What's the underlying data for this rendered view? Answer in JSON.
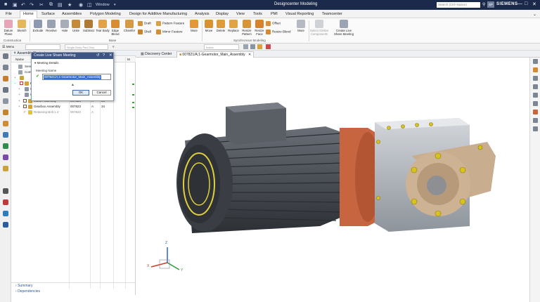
{
  "titlebar": {
    "window_label": "Window",
    "title": "Designcenter  Modeling",
    "search_placeholder": "Search (Ctrl+Space)",
    "brand": "SIEMENS",
    "colors": {
      "background": "#1b2a4a"
    }
  },
  "menu": {
    "tabs": [
      "File",
      "Home",
      "Surface",
      "Assemblies",
      "Polygon Modeling",
      "Design for Additive Manufacturing",
      "Analysis",
      "Display",
      "View",
      "Tools",
      "PMI",
      "Visual Reporting",
      "Teamcenter"
    ],
    "active": "Home"
  },
  "ribbon": {
    "buttons": {
      "datum_plane": "Datum Plane",
      "sketch": "Sketch",
      "extrude": "Extrude",
      "revolve": "Revolve",
      "hole": "Hole",
      "unite": "Unite",
      "subtract": "Subtract",
      "tear_body": "Tear Body",
      "edge_blend": "Edge Blend",
      "chamfer": "Chamfer",
      "draft": "Draft",
      "shell": "Shell",
      "pattern_feature": "Pattern Feature",
      "mirror_feature": "Mirror Feature",
      "more_base": "More",
      "move": "Move",
      "delete": "Delete",
      "replace": "Replace",
      "resize_pattern": "Resize Pattern",
      "resize_face": "Resize Face",
      "offset": "Offset",
      "resize_blend": "Resize Blend",
      "more_sync": "More",
      "select_similar": "Select Similar Components",
      "create_live_share": "Create Live Share Meeting"
    },
    "groups": {
      "construction": "Construction",
      "base": "Base",
      "synchronous": "Synchronous Modeling"
    }
  },
  "toolbar": {
    "menu_label": "Menu",
    "filter_value": "Single Body Part Only",
    "inside_value": "Inside"
  },
  "navigator": {
    "title": "Assembly Navigator",
    "columns": [
      "Name",
      "",
      "",
      "M"
    ],
    "rows": [
      {
        "name": "Sessi",
        "c2": "",
        "c3": "",
        "c4": ""
      },
      {
        "name": "Com",
        "c2": "",
        "c3": "",
        "c4": ""
      },
      {
        "name": "",
        "c2": "",
        "c3": "",
        "c4": ""
      },
      {
        "name": "G",
        "c2": "",
        "c3": "",
        "c4": ""
      },
      {
        "name": "C",
        "c2": "",
        "c3": "",
        "c4": ""
      },
      {
        "name": "C",
        "c2": "",
        "c3": "",
        "c4": ""
      },
      {
        "name": "Motor Assembly",
        "c2": "007824",
        "c3": "A",
        "c4": "86"
      },
      {
        "name": "Gearbox Assembly",
        "c2": "007823",
        "c3": "A",
        "c4": "34"
      },
      {
        "name": "Retaining Bolt x 4",
        "c2": "007822",
        "c3": "A",
        "c4": ""
      }
    ],
    "summary_sections": [
      "Summary",
      "Dependencies"
    ]
  },
  "dialog": {
    "title": "Create Live Share Meeting",
    "section": "Meeting Details",
    "name_label": "Meeting Name",
    "name_value": "007821/A;1-Gearmotor_Main_Assembly",
    "ok_label": "OK",
    "cancel_label": "Cancel"
  },
  "graphics_tabs": [
    {
      "label": "Discovery Center",
      "active": false
    },
    {
      "label": "007821/A;1-Gearmotor_Main_Assembly",
      "active": true
    }
  ],
  "viewport": {
    "triad": {
      "x": "X",
      "y": "Y",
      "z": "Z"
    },
    "colors": {
      "motor": "#4a4e55",
      "gearbox": "#aab0b7",
      "adapter": "#c6653f",
      "flange": "#c9ad8f",
      "bolt": "#d8c21e"
    }
  }
}
